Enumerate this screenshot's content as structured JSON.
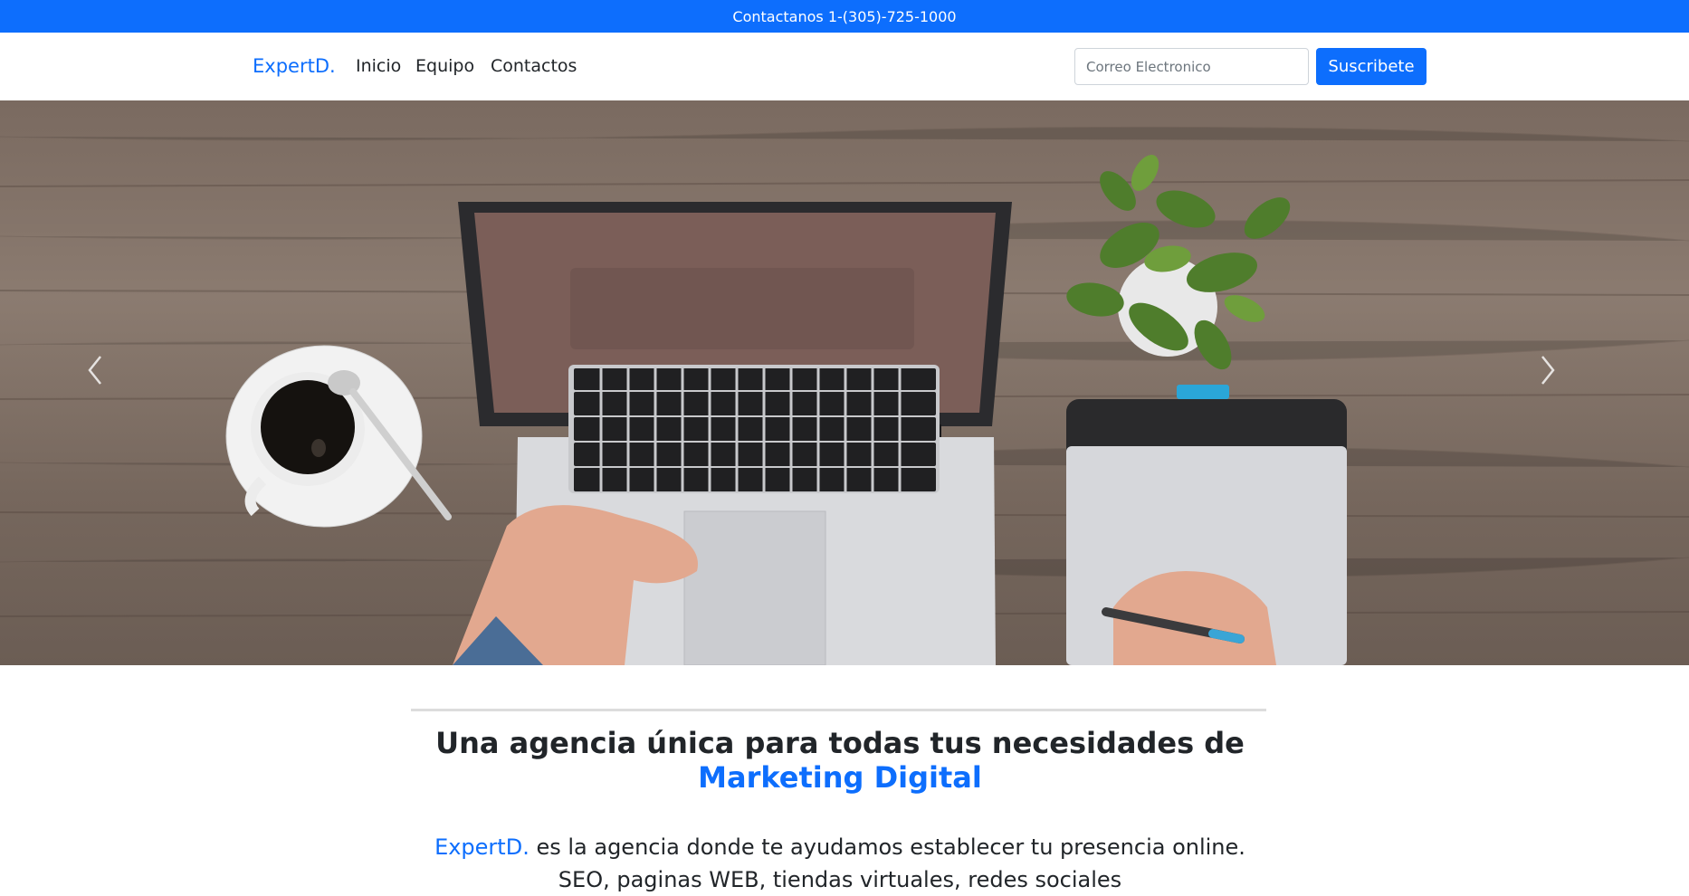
{
  "topbar": {
    "contact_text": "Contactanos 1-(305)-725-1000"
  },
  "navbar": {
    "brand": "ExpertD.",
    "links": [
      "Inicio",
      "Equipo",
      "Contactos"
    ],
    "email_placeholder": "Correo Electronico",
    "subscribe_label": "Suscribete"
  },
  "hero": {
    "prev_icon": "chevron-left-icon",
    "next_icon": "chevron-right-icon"
  },
  "intro": {
    "headline_line1": "Una agencia única para todas tus necesidades de",
    "headline_line2": "Marketing Digital",
    "brand_mention": "ExpertD.",
    "lead_line1": " es la agencia donde te ayudamos establecer tu presencia online.",
    "lead_line2": "SEO, paginas WEB, tiendas virtuales, redes sociales"
  },
  "colors": {
    "primary": "#0d6efd",
    "text": "#212529"
  }
}
